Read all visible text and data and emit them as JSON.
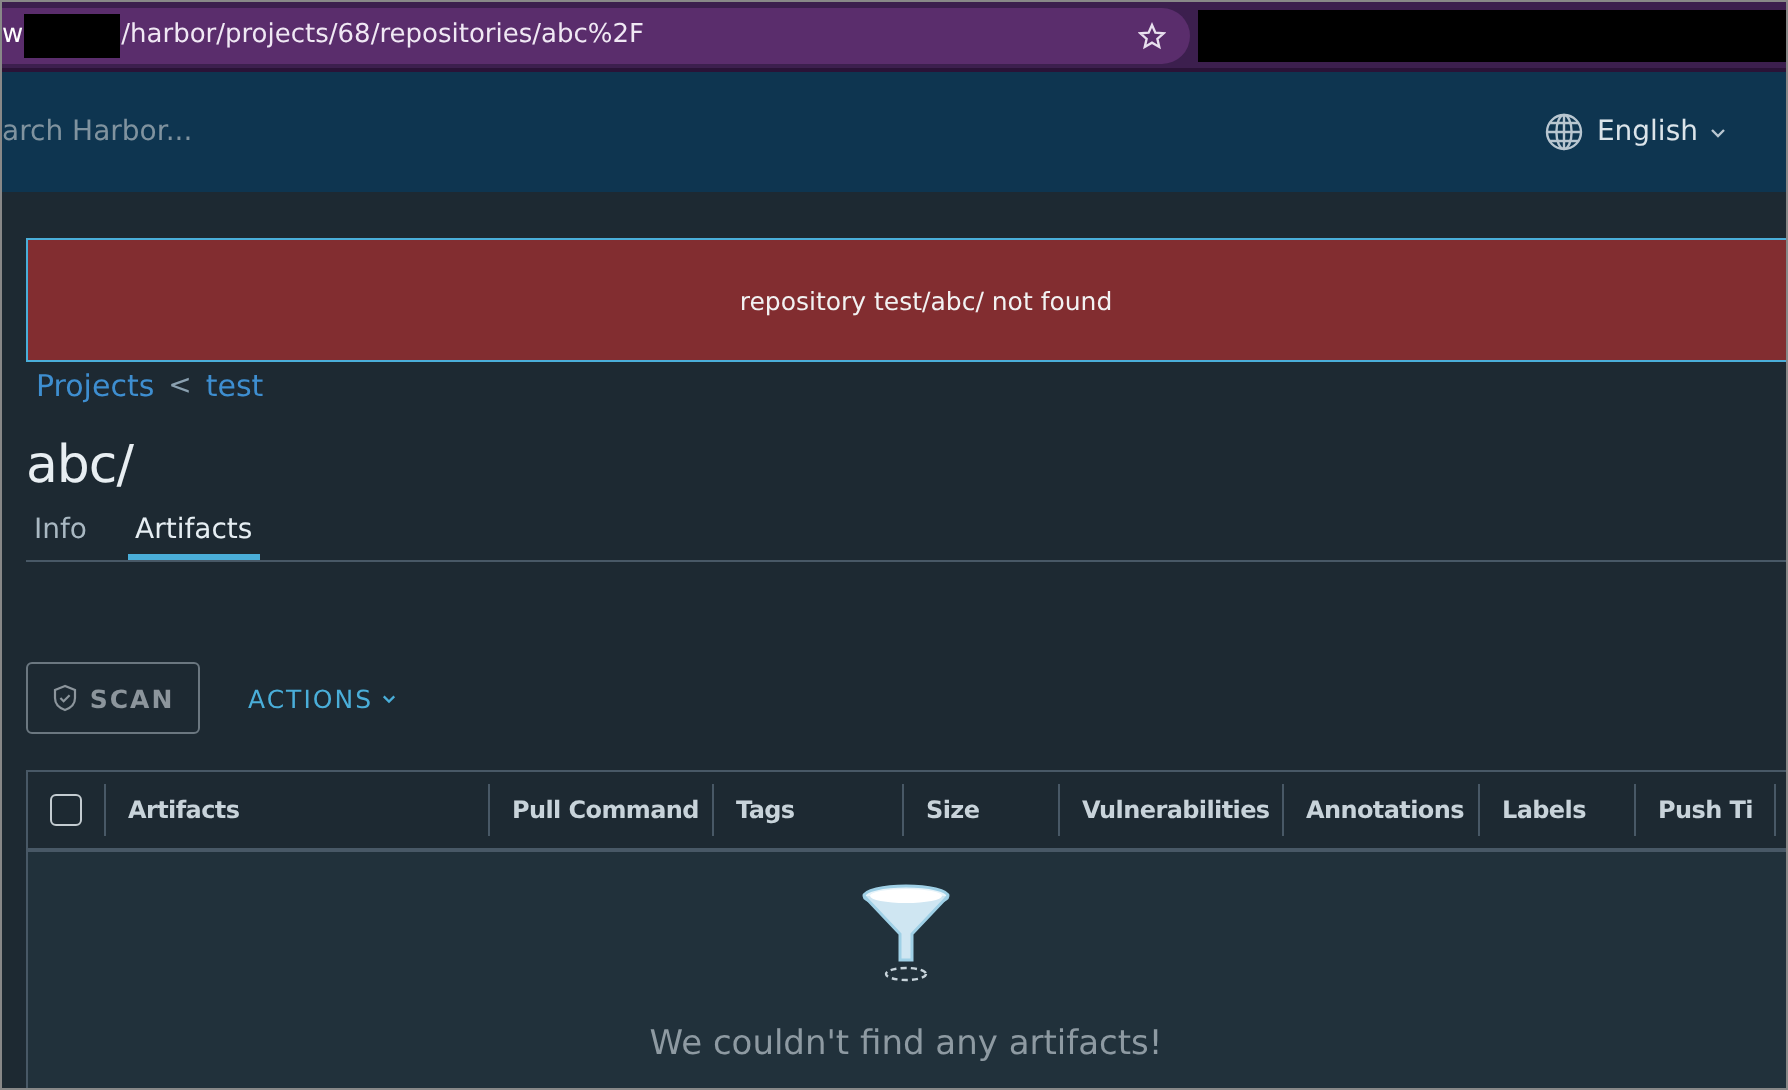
{
  "address_bar": {
    "url_start": "w",
    "url": "/harbor/projects/68/repositories/abc%2F"
  },
  "header": {
    "search": {
      "placeholder": "arch Harbor..."
    },
    "language": "English"
  },
  "alert": {
    "message": "repository test/abc/ not found"
  },
  "breadcrumb": [
    {
      "label": "Projects"
    },
    {
      "separator": "<",
      "label": "test"
    }
  ],
  "title": "abc/",
  "tabs": [
    {
      "label": "Info",
      "selected": false
    },
    {
      "label": "Artifacts",
      "selected": true
    }
  ],
  "toolbar": {
    "scan": "SCAN",
    "actions": "ACTIONS"
  },
  "table": {
    "select_all": {
      "checked": false
    },
    "columns": [
      "Artifacts",
      "Pull Command",
      "Tags",
      "Size",
      "Vulnerabilities",
      "Annotations",
      "Labels",
      "Push Ti"
    ],
    "empty_message": "We couldn't find any artifacts!"
  }
}
